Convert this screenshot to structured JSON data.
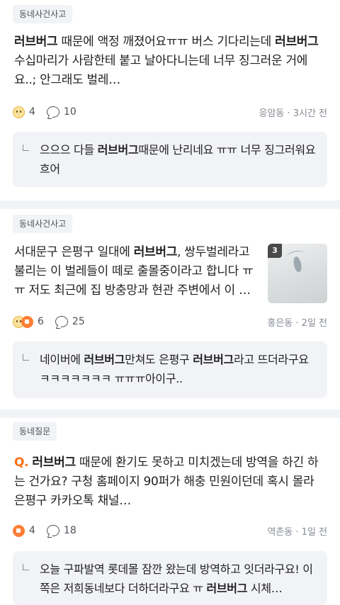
{
  "posts": [
    {
      "tag": "동네사건사고",
      "body_pre": "",
      "body_b1": "러브버그",
      "body_mid1": " 때문에 액정 깨졌어요ㅠㅠ 버스 기다리는데 ",
      "body_b2": "러브버그",
      "body_post": " 수십마리가 사람한테 붙고 날아다니는데 너무 징그러운 거에요..; 안그래도 벌레…",
      "reaction_count": "4",
      "comment_count": "10",
      "location_time": "응암동 · 3시간 전",
      "reply": {
        "pre": "으으으 다들 ",
        "b": "러브버그",
        "post": "때문에 난리네요 ㅠㅠ 너무 징그러워요 흐어"
      }
    },
    {
      "tag": "동네사건사고",
      "body_pre": "서대문구 은평구 일대에 ",
      "body_b1": "러브버그",
      "body_post": ", 쌍두벌레라고 불리는 이 벌레들이 떼로 출몰중이라고 합니다 ㅠㅠ 저도 최근에 집 방충망과 현관 주변에서 이 …",
      "image_count": "3",
      "reaction_count": "6",
      "comment_count": "25",
      "location_time": "홍은동 · 2일 전",
      "reply": {
        "pre": "네이버에 ",
        "b1": "러브버그",
        "mid": "만쳐도 은평구 ",
        "b2": "러브버그",
        "post": "라고 뜨더라구요 ㅋㅋㅋㅋㅋㅋㅋ ㅠㅠㅠ아이구.."
      }
    },
    {
      "tag": "동네질문",
      "q_mark": "Q.",
      "body_b1": "러브버그",
      "body_post": " 때문에 환기도 못하고 미치겠는데 방역을 하긴 하는 건가요? 구청 홈페이지 90퍼가 해충 민원이던데 혹시 몰라 은평구 카카오톡 채널…",
      "reaction_count": "4",
      "comment_count": "18",
      "location_time": "역촌동 · 1일 전",
      "reply": {
        "pre": "오늘 구파발역 롯데몰 잠깐 왔는데 방역하고 잇더라구요! 이쪽은 저희동네보다 더하더라구요 ㅠ ",
        "b": "러브버그",
        "post": " 시체…"
      }
    }
  ],
  "colors": {
    "accent": "#ff6f0f",
    "tag_bg": "#f2f3f6",
    "muted": "#868b94"
  }
}
